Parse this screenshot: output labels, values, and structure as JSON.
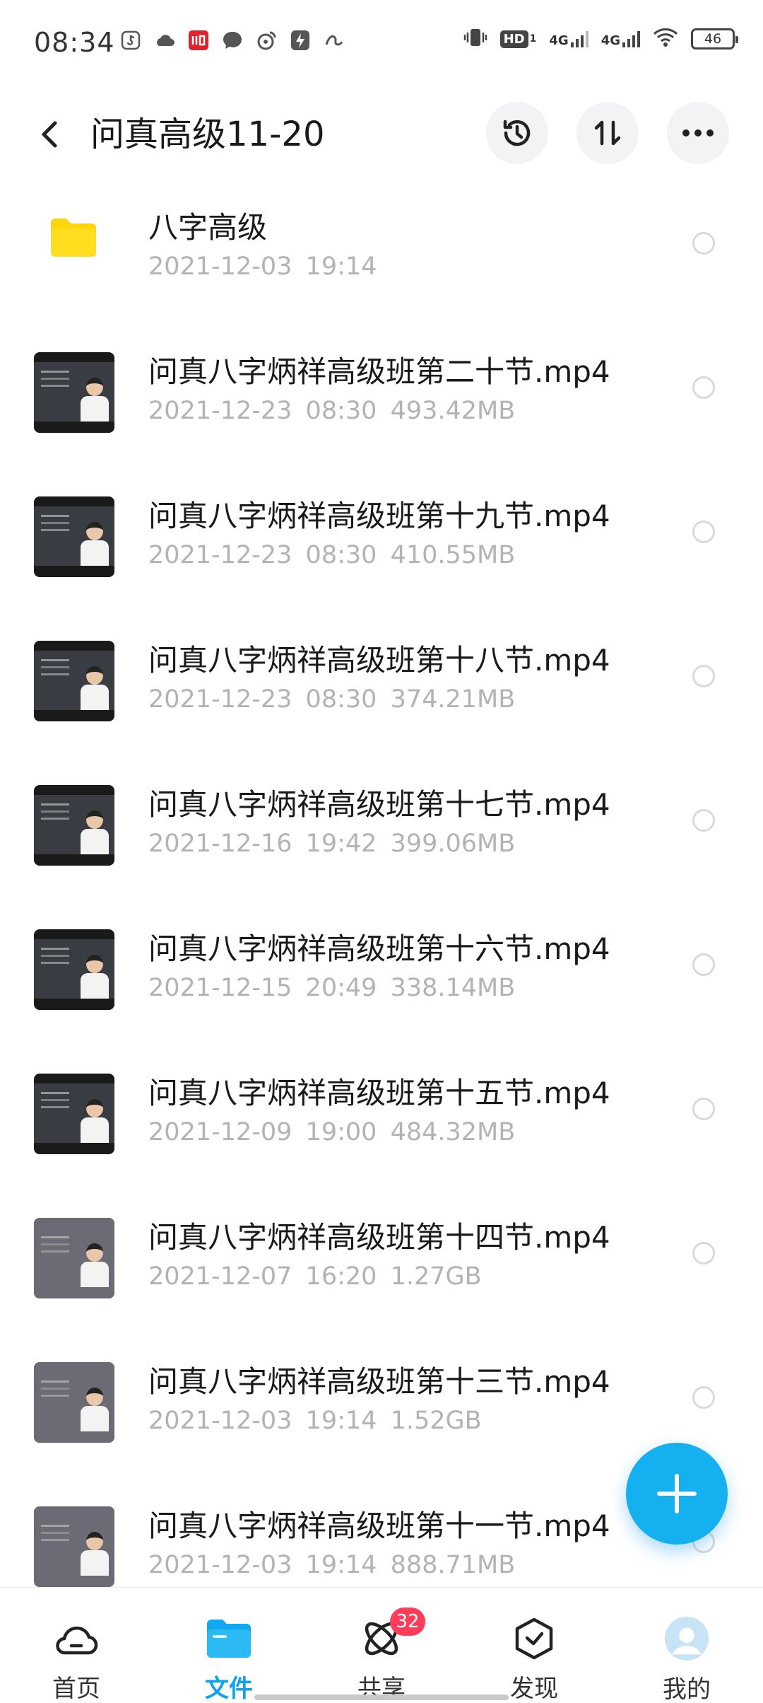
{
  "status_bar": {
    "time": "08:34",
    "left_icons": [
      "tiktok-icon",
      "cloud-icon",
      "iqiyi-icon",
      "message-icon",
      "weibo-icon",
      "bolt-icon",
      "link-icon"
    ],
    "network_1": "4G",
    "network_2": "4G",
    "hd_label": "HD",
    "battery": "46"
  },
  "header": {
    "title": "问真高级11-20",
    "buttons": [
      "history-icon",
      "sort-icon",
      "more-icon"
    ]
  },
  "files": [
    {
      "name": "八字高级",
      "date": "2021-12-03",
      "time": "19:14",
      "size": "",
      "type": "folder"
    },
    {
      "name": "问真八字炳祥高级班第二十节.mp4",
      "date": "2021-12-23",
      "time": "08:30",
      "size": "493.42MB",
      "type": "video"
    },
    {
      "name": "问真八字炳祥高级班第十九节.mp4",
      "date": "2021-12-23",
      "time": "08:30",
      "size": "410.55MB",
      "type": "video"
    },
    {
      "name": "问真八字炳祥高级班第十八节.mp4",
      "date": "2021-12-23",
      "time": "08:30",
      "size": "374.21MB",
      "type": "video"
    },
    {
      "name": "问真八字炳祥高级班第十七节.mp4",
      "date": "2021-12-16",
      "time": "19:42",
      "size": "399.06MB",
      "type": "video"
    },
    {
      "name": "问真八字炳祥高级班第十六节.mp4",
      "date": "2021-12-15",
      "time": "20:49",
      "size": "338.14MB",
      "type": "video"
    },
    {
      "name": "问真八字炳祥高级班第十五节.mp4",
      "date": "2021-12-09",
      "time": "19:00",
      "size": "484.32MB",
      "type": "video"
    },
    {
      "name": "问真八字炳祥高级班第十四节.mp4",
      "date": "2021-12-07",
      "time": "16:20",
      "size": "1.27GB",
      "type": "video-grey"
    },
    {
      "name": "问真八字炳祥高级班第十三节.mp4",
      "date": "2021-12-03",
      "time": "19:14",
      "size": "1.52GB",
      "type": "video-grey"
    },
    {
      "name": "问真八字炳祥高级班第十一节.mp4",
      "date": "2021-12-03",
      "time": "19:14",
      "size": "888.71MB",
      "type": "video-grey"
    }
  ],
  "fab": {
    "icon": "plus-icon"
  },
  "bottom_nav": [
    {
      "label": "首页",
      "icon": "home-cloud-icon",
      "active": false
    },
    {
      "label": "文件",
      "icon": "folder-icon",
      "active": true
    },
    {
      "label": "共享",
      "icon": "share-orbit-icon",
      "active": false,
      "badge": "32"
    },
    {
      "label": "发现",
      "icon": "discover-box-icon",
      "active": false
    },
    {
      "label": "我的",
      "icon": "avatar-icon",
      "active": false
    }
  ],
  "colors": {
    "accent": "#0aa3f0",
    "fab": "#14b0f0",
    "badge": "#ff3d5a",
    "folder": "#ffd60a",
    "meta": "#b3b3b3"
  }
}
